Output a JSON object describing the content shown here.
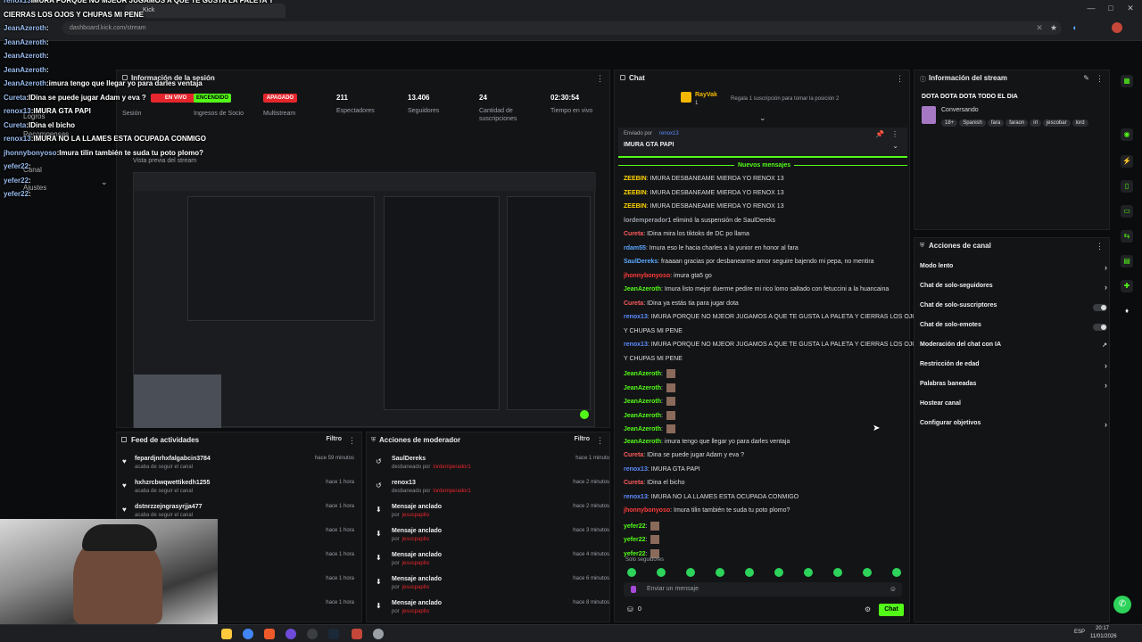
{
  "browser": {
    "url": "dashboard.kick.com/stream",
    "tab_label": "Kick",
    "clock_time": "20:17",
    "clock_date": "11/01/2026",
    "lang": "ESP"
  },
  "overlay_chat": [
    {
      "user": "renox13",
      "msg": "IMURA PORQUE NO MJEOR JUGAMOS A QUE TE GUSTA LA PALETA Y"
    },
    {
      "user": "",
      "msg": "CIERRAS LOS OJOS Y CHUPAS MI PENE"
    },
    {
      "user": "JeanAzeroth",
      "msg": ":"
    },
    {
      "user": "JeanAzeroth",
      "msg": ":"
    },
    {
      "user": "JeanAzeroth",
      "msg": ":"
    },
    {
      "user": "JeanAzeroth",
      "msg": ":"
    },
    {
      "user": "JeanAzeroth",
      "msg": ":imura tengo que llegar yo para darles ventaja"
    },
    {
      "user": "Cureta",
      "msg": ":IDina se puede jugar Adam y eva ?"
    },
    {
      "user": "renox13",
      "msg": ":IMURA GTA PAPI"
    },
    {
      "user": "Cureta",
      "msg": ":IDina el bicho"
    },
    {
      "user": "renox13",
      "msg": ":IMURA NO LA LLAMES ESTA OCUPADA CONMIGO"
    },
    {
      "user": "jhonnybonyoso",
      "msg": ":Imura tilin también te suda tu poto plomo?"
    },
    {
      "user": "yefer22",
      "msg": ":"
    },
    {
      "user": "yefer22",
      "msg": ":"
    },
    {
      "user": "yefer22",
      "msg": ":"
    }
  ],
  "session": {
    "title": "Información de la sesión",
    "status_badges": [
      "EN VIVO",
      "ENCENDIDO",
      "APAGADO"
    ],
    "status_labels": [
      "Sesión",
      "Ingresos de Socio",
      "Multistream"
    ],
    "stats": [
      {
        "value": "211",
        "label": "Espectadores"
      },
      {
        "value": "13.406",
        "label": "Seguidores"
      },
      {
        "value": "24",
        "label": "Cantidad de suscripciones"
      },
      {
        "value": "02:30:54",
        "label": "Tiempo en vivo"
      }
    ],
    "side_labels": [
      "Logros",
      "Recompensas",
      "Canal",
      "Ajustes"
    ],
    "preview_label": "Vista previa del stream"
  },
  "chat": {
    "title": "Chat",
    "top_user": "RayVak",
    "top_user_count": "1",
    "gift_prompt": "Regala 1 suscripción para tomar la posición 2",
    "pinned_by_label": "Enviado por",
    "pinned_by_user": "renox13",
    "pinned_msg": "IMURA GTA PAPI",
    "new_messages": "Nuevos mensajes",
    "messages": [
      {
        "user": "ZEEBIN",
        "text": ": IMURA DESBANEAME MIERDA YO RENOX 13",
        "color": "#ffd400"
      },
      {
        "user": "ZEEBIN",
        "text": ": IMURA DESBANEAME MIERDA YO RENOX 13",
        "color": "#ffd400"
      },
      {
        "user": "ZEEBIN",
        "text": ": IMURA DESBANEAME MIERDA YO RENOX 13",
        "color": "#ffd400"
      },
      {
        "user": "lordemperador1",
        "text": " eliminó la suspensión de SaulDereks",
        "color": "#9aa0a6"
      },
      {
        "user": "Cureta",
        "text": ": IDina mira los tiktoks de DC po llama",
        "color": "#ff5c5c"
      },
      {
        "user": "rdam55",
        "text": ": Imura eso le hacia charles a la yunior en honor al fara",
        "color": "#5ca8ff"
      },
      {
        "user": "SaulDereks",
        "text": ": fraaaan gracias por desbanearme amor seguire bajendo mi pepa, no mentira",
        "color": "#5ca8ff"
      },
      {
        "user": "jhonnybonyoso",
        "text": ": imura gta5 go",
        "color": "#ff3b3b"
      },
      {
        "user": "JeanAzeroth",
        "text": ": Imura listo mejor duerme pedire mi rico lomo saltado con fetuccini a la huancaina",
        "color": "#53fc18"
      },
      {
        "user": "Cureta",
        "text": ": IDina ya estás tia para jugar dota",
        "color": "#ff5c5c"
      },
      {
        "user": "renox13",
        "text": ": IMURA PORQUE NO MJEOR JUGAMOS A QUE TE GUSTA LA PALETA Y CIERRAS LOS OJOS",
        "color": "#5c8cff"
      },
      {
        "user": "",
        "text": "Y CHUPAS MI PENE",
        "color": "#ddd"
      },
      {
        "user": "renox13",
        "text": ": IMURA PORQUE NO MJEOR JUGAMOS A QUE TE GUSTA LA PALETA Y CIERRAS LOS OJOS",
        "color": "#5c8cff"
      },
      {
        "user": "",
        "text": "Y CHUPAS MI PENE",
        "color": "#ddd"
      },
      {
        "user": "JeanAzeroth",
        "text": ":",
        "color": "#53fc18"
      },
      {
        "user": "JeanAzeroth",
        "text": ":",
        "color": "#53fc18"
      },
      {
        "user": "JeanAzeroth",
        "text": ":",
        "color": "#53fc18"
      },
      {
        "user": "JeanAzeroth",
        "text": ":",
        "color": "#53fc18"
      },
      {
        "user": "JeanAzeroth",
        "text": ":",
        "color": "#53fc18"
      },
      {
        "user": "JeanAzeroth",
        "text": ": imura tengo que llegar yo para darles ventaja",
        "color": "#53fc18"
      },
      {
        "user": "Cureta",
        "text": ": IDina se puede jugar Adam y eva ?",
        "color": "#ff5c5c"
      },
      {
        "user": "renox13",
        "text": ": IMURA GTA PAPI",
        "color": "#5c8cff"
      },
      {
        "user": "Cureta",
        "text": ": IDina el bicho",
        "color": "#ff5c5c"
      },
      {
        "user": "renox13",
        "text": ": IMURA NO LA LLAMES ESTA OCUPADA CONMIGO",
        "color": "#5c8cff"
      },
      {
        "user": "jhonnybonyoso",
        "text": ": Imura tilin también te suda tu poto plomo?",
        "color": "#ff3b3b"
      },
      {
        "user": "yefer22",
        "text": ":",
        "color": "#53fc18"
      },
      {
        "user": "yefer22",
        "text": ":",
        "color": "#53fc18"
      },
      {
        "user": "yefer22",
        "text": ":",
        "color": "#53fc18"
      }
    ],
    "followers_only": "Solo seguidores",
    "input_placeholder": "Enviar un mensaje",
    "points": "0",
    "send_label": "Chat"
  },
  "stream_info": {
    "title": "Información del stream",
    "stream_title": "DOTA DOTA DOTA TODO EL DIA",
    "category": "Conversando",
    "tags": [
      "18+",
      "Spanish",
      "fara",
      "faraon",
      "irl",
      "jescobar",
      "lord"
    ]
  },
  "channel_actions": {
    "title": "Acciones de canal",
    "rows": [
      {
        "label": "Modo lento",
        "control": "chevron"
      },
      {
        "label": "Chat de solo-seguidores",
        "control": "chevron"
      },
      {
        "label": "Chat de solo-suscriptores",
        "control": "toggle"
      },
      {
        "label": "Chat de solo-emotes",
        "control": "toggle"
      },
      {
        "label": "Moderación del chat con IA",
        "control": "external"
      },
      {
        "label": "Restricción de edad",
        "control": "chevron"
      },
      {
        "label": "Palabras baneadas",
        "control": "chevron"
      },
      {
        "label": "Hostear canal",
        "control": "none"
      },
      {
        "label": "Configurar objetivos",
        "control": "chevron"
      }
    ]
  },
  "activity_feed": {
    "title": "Feed de actividades",
    "filter": "Filtro",
    "items": [
      {
        "name": "fepardjnrhxfalgabcin3784",
        "sub": "acaba de seguir el canal",
        "time": "hace 59 minutos"
      },
      {
        "name": "hxhzrcbwqwettikedh1255",
        "sub": "acaba de seguir el canal",
        "time": "hace 1 hora"
      },
      {
        "name": "dstnrzzejngrasyrjja477",
        "sub": "acaba de seguir el canal",
        "time": "hace 1 hora"
      },
      {
        "name": "",
        "sub": "",
        "time": "hace 1 hora"
      },
      {
        "name": "",
        "sub": "",
        "time": "hace 1 hora"
      },
      {
        "name": "",
        "sub": "",
        "time": "hace 1 hora"
      },
      {
        "name": "",
        "sub": "",
        "time": "hace 1 hora"
      }
    ]
  },
  "mod_actions": {
    "title": "Acciones de moderador",
    "filter": "Filtro",
    "items": [
      {
        "name": "SaulDereks",
        "sub": "desbaneado por",
        "by": "lordemperador1",
        "time": "hace 1 minuto"
      },
      {
        "name": "renox13",
        "sub": "desbaneado por",
        "by": "lordemperador1",
        "time": "hace 2 minutos"
      },
      {
        "name": "Mensaje anclado",
        "sub": "por",
        "by": "jesuspapito",
        "time": "hace 2 minutos"
      },
      {
        "name": "Mensaje anclado",
        "sub": "por",
        "by": "jesuspapito",
        "time": "hace 3 minutos"
      },
      {
        "name": "Mensaje anclado",
        "sub": "por",
        "by": "jesuspapito",
        "time": "hace 4 minutos"
      },
      {
        "name": "Mensaje anclado",
        "sub": "por",
        "by": "jesuspapito",
        "time": "hace 6 minutos"
      },
      {
        "name": "Mensaje anclado",
        "sub": "por",
        "by": "jesuspapito",
        "time": "hace 8 minutos"
      }
    ]
  },
  "colors": {
    "accent": "#53fc18",
    "live": "#e6262d",
    "panel": "#131416"
  }
}
